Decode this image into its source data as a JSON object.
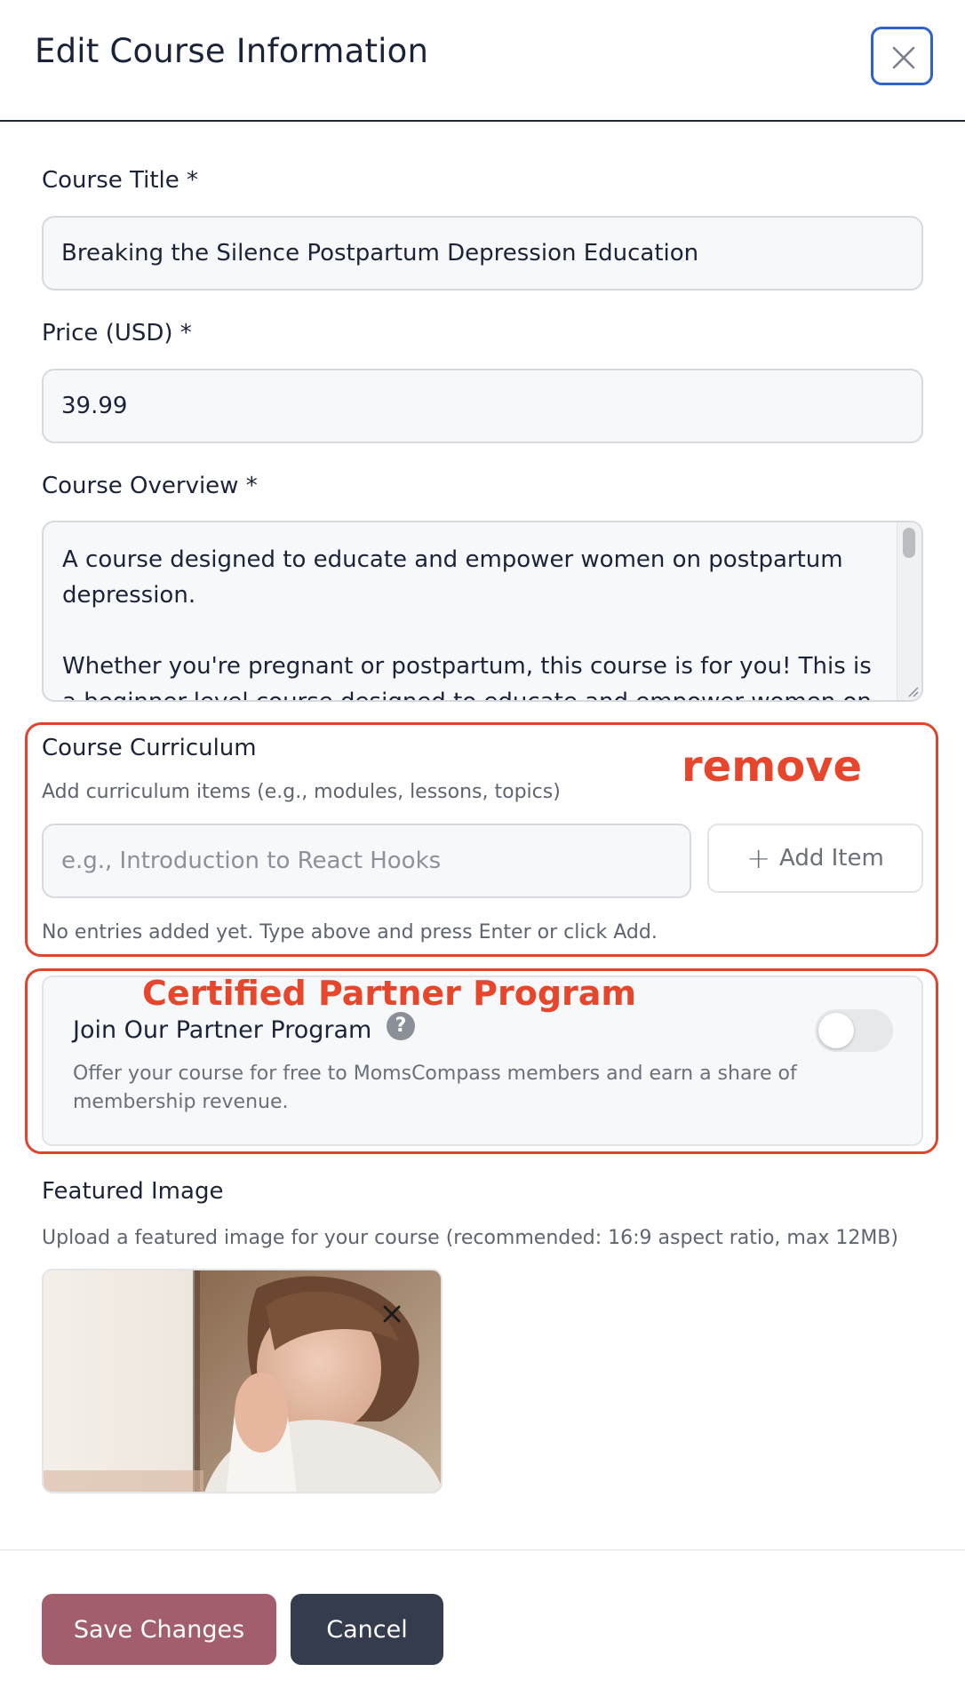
{
  "header": {
    "title": "Edit Course Information",
    "close_icon": "close-icon"
  },
  "course_title": {
    "label": "Course Title *",
    "value": "Breaking the Silence Postpartum Depression Education"
  },
  "price": {
    "label": "Price (USD) *",
    "value": "39.99"
  },
  "overview": {
    "label": "Course Overview *",
    "paragraph1": "A course designed to educate and empower women on postpartum depression.",
    "paragraph2": "Whether you're pregnant or postpartum, this course is for you! This is a beginner-level course designed to educate and empower women on"
  },
  "curriculum": {
    "label": "Course Curriculum",
    "description": "Add curriculum items (e.g., modules, lessons, topics)",
    "placeholder": "e.g., Introduction to React Hooks",
    "add_label": "Add Item",
    "empty_message": "No entries added yet. Type above and press Enter or click Add."
  },
  "partner": {
    "title": "Join Our Partner Program",
    "help_glyph": "?",
    "description": "Offer your course for free to MomsCompass members and earn a share of membership revenue.",
    "toggle_on": false
  },
  "featured_image": {
    "label": "Featured Image",
    "description": "Upload a featured image for your course (recommended: 16:9 aspect ratio, max 12MB)"
  },
  "footer": {
    "save_label": "Save Changes",
    "cancel_label": "Cancel"
  },
  "annotations": {
    "remove": "remove",
    "partner": "Certified Partner Program",
    "color": "#e8462c"
  },
  "colors": {
    "accent": "#2f63c9",
    "save": "#a25e6c",
    "cancel": "#353c4d"
  }
}
